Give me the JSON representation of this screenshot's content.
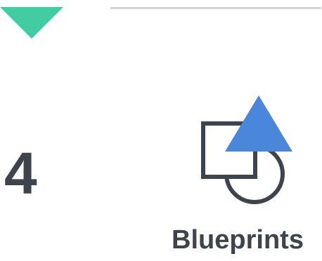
{
  "step": {
    "number": "4",
    "title": "Blueprints"
  },
  "icons": {
    "marker": "triangle-down-icon",
    "illustration": "shapes-icon"
  },
  "colors": {
    "marker": "#43cca1",
    "accent": "#4a86d9",
    "ink": "#3e444c",
    "divider": "#d3d5db"
  }
}
